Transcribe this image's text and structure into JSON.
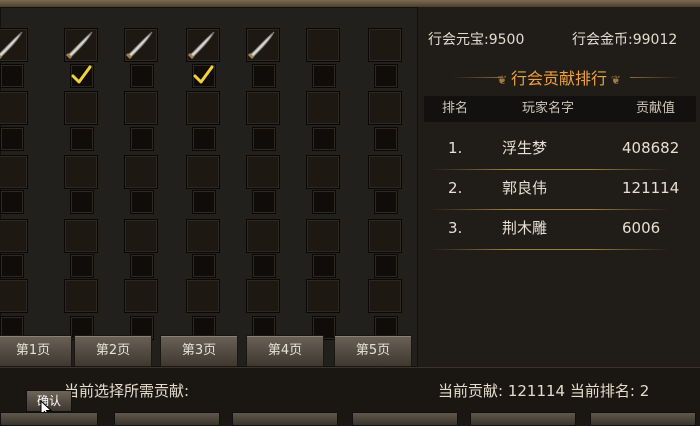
{
  "guild_resources": {
    "yuanbao_label": "行会元宝:",
    "yuanbao_value": "9500",
    "gold_label": "行会金币:",
    "gold_value": "99012"
  },
  "ranking": {
    "title": "行会贡献排行",
    "headers": [
      "排名",
      "玩家名字",
      "贡献值"
    ],
    "rows": [
      {
        "rank": "1.",
        "name": "浮生梦",
        "value": "408682"
      },
      {
        "rank": "2.",
        "name": "郭良伟",
        "value": "121114"
      },
      {
        "rank": "3.",
        "name": "荆木雕",
        "value": "6006"
      }
    ]
  },
  "item_grid": {
    "columns": 7,
    "swords_in_columns": [
      1,
      2,
      3,
      4,
      5
    ],
    "checked_columns": [
      2,
      4
    ]
  },
  "pages": [
    "第1页",
    "第2页",
    "第3页",
    "第4页",
    "第5页"
  ],
  "footer": {
    "selected_cost_label": "当前选择所需贡献:",
    "current_contribution_label": "当前贡献:",
    "current_contribution_value": "121114",
    "current_rank_label": "当前排名:",
    "current_rank_value": "2",
    "confirm_label": "确认"
  },
  "colors": {
    "rank_title": "#f0a040",
    "check": "#f2d23a"
  }
}
